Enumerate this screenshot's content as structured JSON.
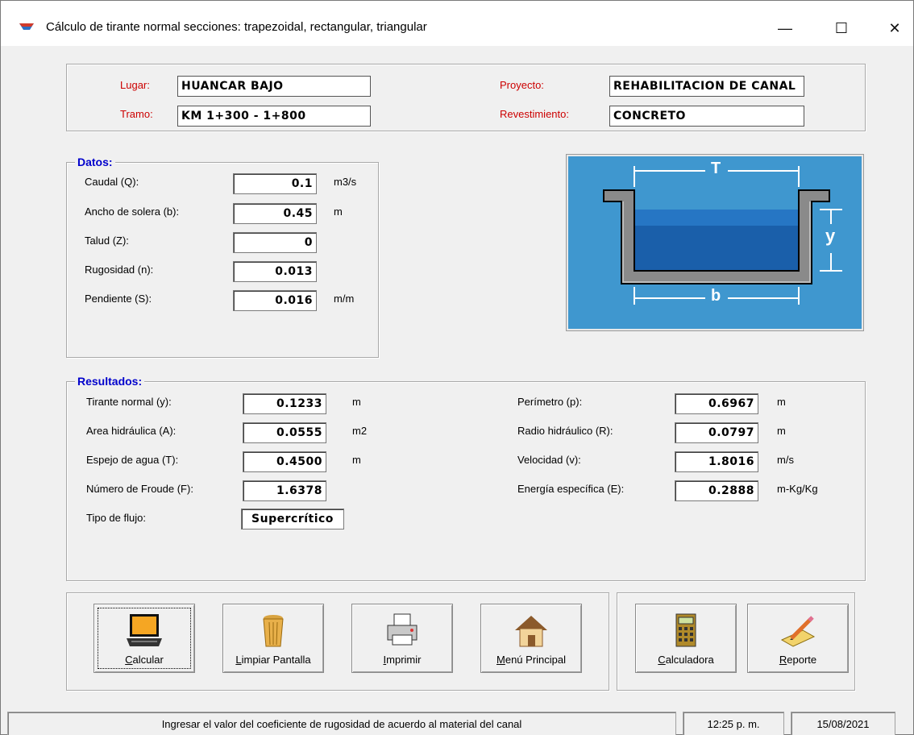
{
  "window": {
    "title": "Cálculo de tirante normal secciones: trapezoidal, rectangular, triangular",
    "minimize": "—",
    "maximize": "☐",
    "close": "✕"
  },
  "header": {
    "lugar_label": "Lugar:",
    "lugar_value": "HUANCAR BAJO",
    "tramo_label": "Tramo:",
    "tramo_value": "KM 1+300 - 1+800",
    "proyecto_label": "Proyecto:",
    "proyecto_value": "REHABILITACION DE CANAL",
    "revestimiento_label": "Revestimiento:",
    "revestimiento_value": "CONCRETO"
  },
  "datos": {
    "legend": "Datos:",
    "rows": [
      {
        "label": "Caudal (Q):",
        "value": "0.1",
        "unit": "m3/s"
      },
      {
        "label": "Ancho de solera (b):",
        "value": "0.45",
        "unit": "m"
      },
      {
        "label": "Talud (Z):",
        "value": "0",
        "unit": ""
      },
      {
        "label": "Rugosidad (n):",
        "value": "0.013",
        "unit": ""
      },
      {
        "label": "Pendiente (S):",
        "value": "0.016",
        "unit": "m/m"
      }
    ]
  },
  "diagram": {
    "T": "T",
    "y": "y",
    "b": "b",
    "water_color": "#1f6fb8",
    "bg_color": "#3f97cf"
  },
  "resultados": {
    "legend": "Resultados:",
    "left": [
      {
        "label": "Tirante normal (y):",
        "value": "0.1233",
        "unit": "m"
      },
      {
        "label": "Area hidráulica (A):",
        "value": "0.0555",
        "unit": "m2"
      },
      {
        "label": "Espejo de agua (T):",
        "value": "0.4500",
        "unit": "m"
      },
      {
        "label": "Número de Froude (F):",
        "value": "1.6378",
        "unit": ""
      },
      {
        "label": "Tipo de flujo:",
        "value": "Supercrítico",
        "unit": ""
      }
    ],
    "right": [
      {
        "label": "Perímetro (p):",
        "value": "0.6967",
        "unit": "m"
      },
      {
        "label": "Radio hidráulico (R):",
        "value": "0.0797",
        "unit": "m"
      },
      {
        "label": "Velocidad (v):",
        "value": "1.8016",
        "unit": "m/s"
      },
      {
        "label": "Energía específica (E):",
        "value": "0.2888",
        "unit": "m-Kg/Kg"
      }
    ]
  },
  "buttons": {
    "calcular": {
      "u": "C",
      "rest": "alcular"
    },
    "limpiar": {
      "u": "L",
      "rest": "impiar Pantalla"
    },
    "imprimir": {
      "u": "I",
      "rest": "mprimir"
    },
    "menu": {
      "u": "M",
      "rest": "enú Principal"
    },
    "calculadora": {
      "u": "C",
      "rest": "alculadora"
    },
    "reporte": {
      "u": "R",
      "rest": "eporte"
    }
  },
  "status": {
    "message": "Ingresar el valor del coeficiente de rugosidad de acuerdo al material del canal",
    "time": "12:25 p. m.",
    "date": "15/08/2021"
  }
}
